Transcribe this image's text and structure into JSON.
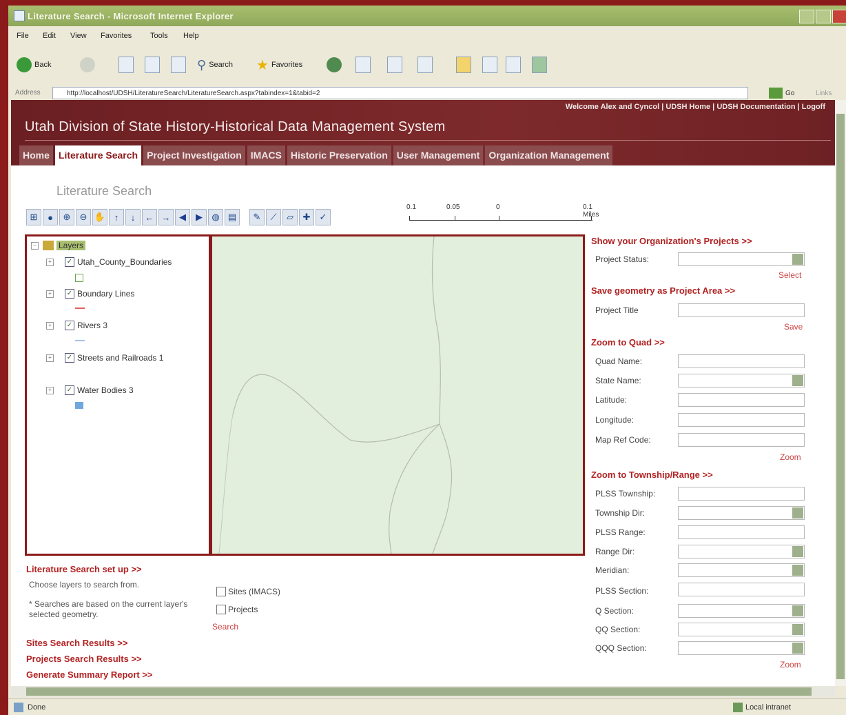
{
  "window": {
    "title": "Literature Search - Microsoft Internet Explorer"
  },
  "menu": {
    "items": [
      "File",
      "Edit",
      "View",
      "Favorites",
      "Tools",
      "Help"
    ]
  },
  "toolbar": {
    "back": "Back",
    "search": "Search",
    "favorites": "Favorites"
  },
  "address": {
    "label": "Address",
    "url": "http://localhost/UDSH/LiteratureSearch/LiteratureSearch.aspx?tabindex=1&tabid=2",
    "go": "Go",
    "links": "Links"
  },
  "header": {
    "welcome": "Welcome Alex and Cyncol | UDSH Home | UDSH Documentation | Logoff",
    "title": "Utah Division of State History-Historical Data Management System"
  },
  "tabs": [
    "Home",
    "Literature Search",
    "Project Investigation",
    "IMACS",
    "Historic Preservation",
    "User Management",
    "Organization Management"
  ],
  "page_title": "Literature Search",
  "scale": {
    "labels": [
      "0.1",
      "0.05",
      "0",
      "0.1 Miles"
    ]
  },
  "layers": {
    "root": "Layers",
    "items": [
      {
        "label": "Utah_County_Boundaries",
        "symbol_color": "#6aa84f"
      },
      {
        "label": "Boundary Lines",
        "symbol_color": "#e06060"
      },
      {
        "label": "Rivers 3",
        "symbol_color": "#9fc5e8"
      },
      {
        "label": "Streets and Railroads 1",
        "symbol_color": ""
      },
      {
        "label": "Water Bodies 3",
        "symbol_color": "#6fa8dc"
      }
    ]
  },
  "right": {
    "org_projects": {
      "heading": "Show your Organization's Projects >>",
      "status_label": "Project Status:",
      "select": "Select"
    },
    "save_geom": {
      "heading": "Save geometry as Project Area >>",
      "title_label": "Project Title",
      "save": "Save"
    },
    "zoom_quad": {
      "heading": "Zoom to Quad >>",
      "quad": "Quad Name:",
      "state": "State Name:",
      "lat": "Latitude:",
      "lon": "Longitude:",
      "mapref": "Map Ref Code:",
      "zoom": "Zoom"
    },
    "zoom_trs": {
      "heading": "Zoom to Township/Range >>",
      "township": "PLSS Township:",
      "township_dir": "Township Dir:",
      "range": "PLSS Range:",
      "range_dir": "Range Dir:",
      "meridian": "Meridian:",
      "section": "PLSS Section:",
      "q": "Q Section:",
      "qq": "QQ Section:",
      "qqq": "QQQ Section:",
      "zoom": "Zoom"
    }
  },
  "setup": {
    "heading": "Literature Search set up >>",
    "choose": "Choose layers to search from.",
    "note": "* Searches are based on the current layer's selected geometry.",
    "opt_sites": "Sites (IMACS)",
    "opt_projects": "Projects",
    "search": "Search"
  },
  "results": {
    "sites": "Sites Search Results >>",
    "projects": "Projects Search Results >>",
    "summary": "Generate Summary Report >>"
  },
  "status": {
    "left": "Done",
    "right": "Local intranet"
  },
  "colors": {
    "brand": "#7e2a2c",
    "accent": "#b22222",
    "map_bg": "#e2efdc"
  }
}
